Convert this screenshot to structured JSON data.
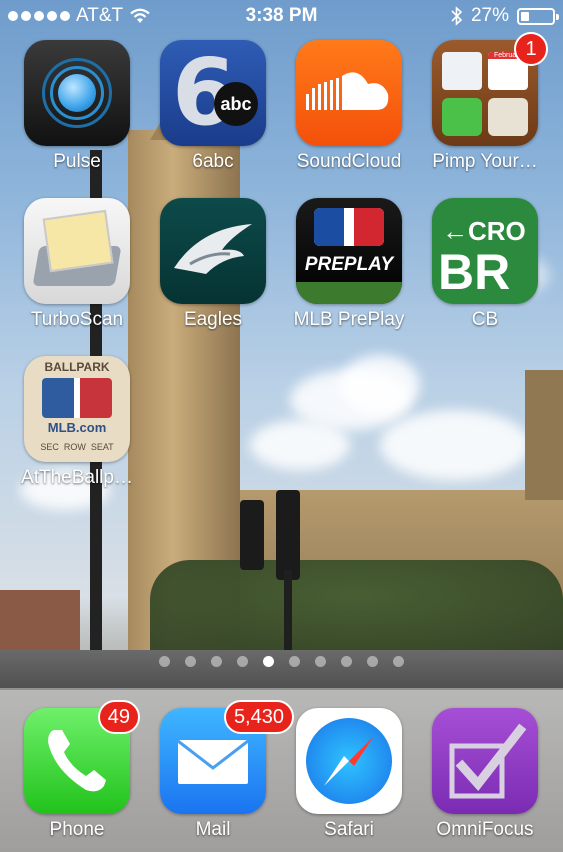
{
  "status": {
    "carrier": "AT&T",
    "time": "3:38 PM",
    "battery": "27%"
  },
  "apps": [
    {
      "label": "Pulse",
      "icon": "pulse-icon"
    },
    {
      "label": "6abc",
      "icon": "6abc-icon",
      "icon_text": "abc"
    },
    {
      "label": "SoundCloud",
      "icon": "soundcloud-icon"
    },
    {
      "label": "Pimp Your…",
      "icon": "pimp-your-screen-icon",
      "badge": "1",
      "icon_text": "February"
    },
    {
      "label": "TurboScan",
      "icon": "turboscan-icon"
    },
    {
      "label": "Eagles",
      "icon": "eagles-icon"
    },
    {
      "label": "MLB PrePlay",
      "icon": "mlb-preplay-icon",
      "icon_text": "PREPLAY"
    },
    {
      "label": "CB",
      "icon": "cb-icon",
      "icon_text": "←CRO",
      "icon_text2": "BR"
    },
    {
      "label": "AtTheBallp…",
      "icon": "at-the-ballpark-icon",
      "icon_text": "BALLPARK",
      "icon_text2": "MLB.com",
      "icon_text3": "SEC  ROW  SEAT"
    }
  ],
  "dock": [
    {
      "label": "Phone",
      "icon": "phone-icon",
      "badge": "49"
    },
    {
      "label": "Mail",
      "icon": "mail-icon",
      "badge": "5,430"
    },
    {
      "label": "Safari",
      "icon": "safari-icon"
    },
    {
      "label": "OmniFocus",
      "icon": "omnifocus-icon"
    }
  ],
  "page_indicator": {
    "pages": 10,
    "current": 5
  }
}
